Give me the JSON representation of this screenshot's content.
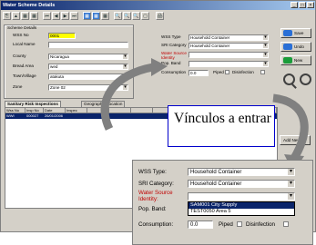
{
  "window": {
    "title": "Water Scheme Details",
    "controls": [
      "_",
      "□",
      "×"
    ]
  },
  "toolbar": {
    "buttons": [
      "⎘",
      "▲",
      "▦",
      "▦",
      "⏮",
      "◀",
      "▶",
      "⏭",
      "▦",
      "▦",
      "▦",
      "🔍",
      "🔍",
      "🔍",
      "▢",
      "🖨"
    ]
  },
  "scheme": {
    "group_title": "Scheme Details",
    "wss_no_label": "WSS No",
    "wss_no_value": "0001",
    "local_name_label": "Local Name",
    "local_name_value": "",
    "county_label": "County",
    "county_value": "Nicaragua",
    "bread_area_label": "Bread Area",
    "bread_area_value": "wed",
    "town_village_label": "Town/Village",
    "town_village_value": "atakuta",
    "zone_label": "Zone",
    "zone_value": "Zone 02"
  },
  "right_panel": {
    "wss_type_label": "WSS Type",
    "wss_type_value": "Household Container",
    "sri_category_label": "SRI Category",
    "sri_category_value": "Household Container",
    "water_source_label": "Water Source Identity",
    "pop_band_label": "Pop. Band",
    "consumption_label": "Consumption",
    "consumption_value": "0.0",
    "piped_label": "Piped",
    "disinfection_label": "Disinfection"
  },
  "side_buttons": [
    {
      "label": "Save",
      "color": "#2a6fd6"
    },
    {
      "label": "Undo",
      "color": "#2a6fd6"
    },
    {
      "label": "New",
      "color": "#1a9c3a"
    }
  ],
  "tabs": [
    "Sanitary Risk Inspections",
    "Geographic Location"
  ],
  "grid": {
    "headers": [
      "Wss No",
      "Insp No",
      "Date",
      "Inspec",
      "",
      "",
      "",
      ""
    ],
    "row": [
      "WWI",
      "000027",
      "26/01/2006",
      "",
      "",
      "",
      "",
      ""
    ]
  },
  "callout": {
    "text": "Vínculos a entrar"
  },
  "add_button": "Add New",
  "zoom_panel": {
    "wss_type_label": "WSS Type:",
    "wss_type_value": "Household Container",
    "sri_category_label": "SRI Category:",
    "sri_category_value": "Household Container",
    "water_source_label": "Water Source Identity:",
    "pop_band_label": "Pop. Band:",
    "dropdown_options": [
      "SAM001 City Supply",
      "TEST0050 Area 5"
    ],
    "consumption_label": "Consumption:",
    "consumption_value": "0.0",
    "piped_label": "Piped",
    "disinfection_label": "Disinfection"
  },
  "colors": {
    "title_bar": "#0a246a",
    "selection": "#0a246a",
    "highlight": "#ffff00",
    "required_label": "#c00000",
    "callout_border": "#0000cc"
  }
}
